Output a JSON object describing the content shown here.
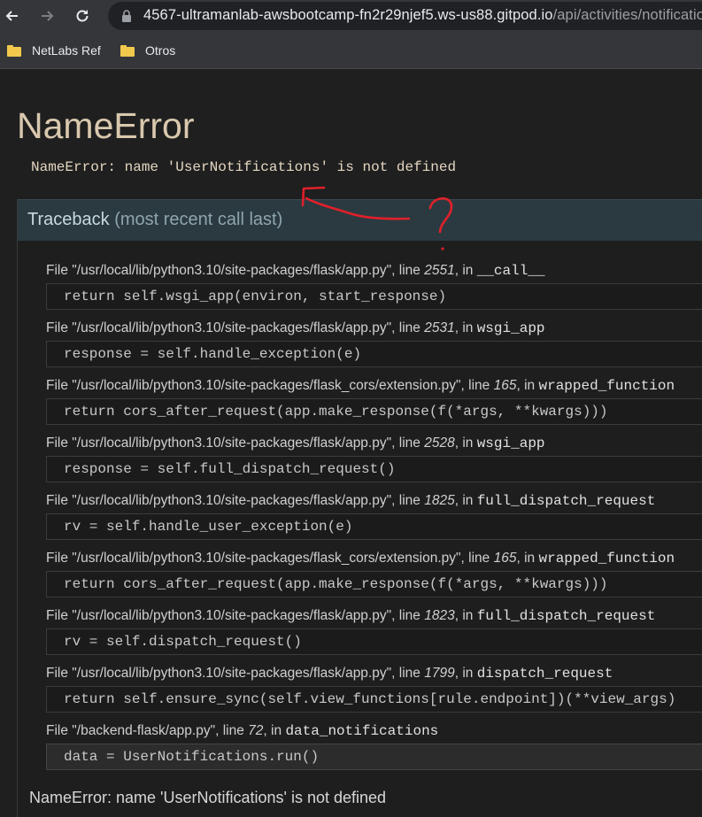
{
  "browser": {
    "url_host": "4567-ultramanlab-awsbootcamp-fn2r29njef5.ws-us88.gitpod.io",
    "url_path": "/api/activities/notifications",
    "bookmarks": [
      "NetLabs Ref",
      "Otros"
    ]
  },
  "error": {
    "title": "NameError",
    "message": "NameError: name 'UserNotifications' is not defined"
  },
  "traceback": {
    "title": "Traceback",
    "subtitle": "(most recent call last)",
    "frames": [
      {
        "file": "\"/usr/local/lib/python3.10/site-packages/flask/app.py\"",
        "line": "2551",
        "func": "__call__",
        "code": "return self.wsgi_app(environ, start_response)"
      },
      {
        "file": "\"/usr/local/lib/python3.10/site-packages/flask/app.py\"",
        "line": "2531",
        "func": "wsgi_app",
        "code": "response = self.handle_exception(e)"
      },
      {
        "file": "\"/usr/local/lib/python3.10/site-packages/flask_cors/extension.py\"",
        "line": "165",
        "func": "wrapped_function",
        "code": "return cors_after_request(app.make_response(f(*args, **kwargs)))"
      },
      {
        "file": "\"/usr/local/lib/python3.10/site-packages/flask/app.py\"",
        "line": "2528",
        "func": "wsgi_app",
        "code": "response = self.full_dispatch_request()"
      },
      {
        "file": "\"/usr/local/lib/python3.10/site-packages/flask/app.py\"",
        "line": "1825",
        "func": "full_dispatch_request",
        "code": "rv = self.handle_user_exception(e)"
      },
      {
        "file": "\"/usr/local/lib/python3.10/site-packages/flask_cors/extension.py\"",
        "line": "165",
        "func": "wrapped_function",
        "code": "return cors_after_request(app.make_response(f(*args, **kwargs)))"
      },
      {
        "file": "\"/usr/local/lib/python3.10/site-packages/flask/app.py\"",
        "line": "1823",
        "func": "full_dispatch_request",
        "code": "rv = self.dispatch_request()"
      },
      {
        "file": "\"/usr/local/lib/python3.10/site-packages/flask/app.py\"",
        "line": "1799",
        "func": "dispatch_request",
        "code": "return self.ensure_sync(self.view_functions[rule.endpoint])(**view_args)"
      },
      {
        "file": "\"/backend-flask/app.py\"",
        "line": "72",
        "func": "data_notifications",
        "code": "data = UserNotifications.run()"
      }
    ],
    "footer": "NameError: name 'UserNotifications' is not defined"
  },
  "labels": {
    "file_word": "File",
    "line_word": "line",
    "in_word": "in"
  },
  "colors": {
    "annotation": "#e0202a"
  }
}
